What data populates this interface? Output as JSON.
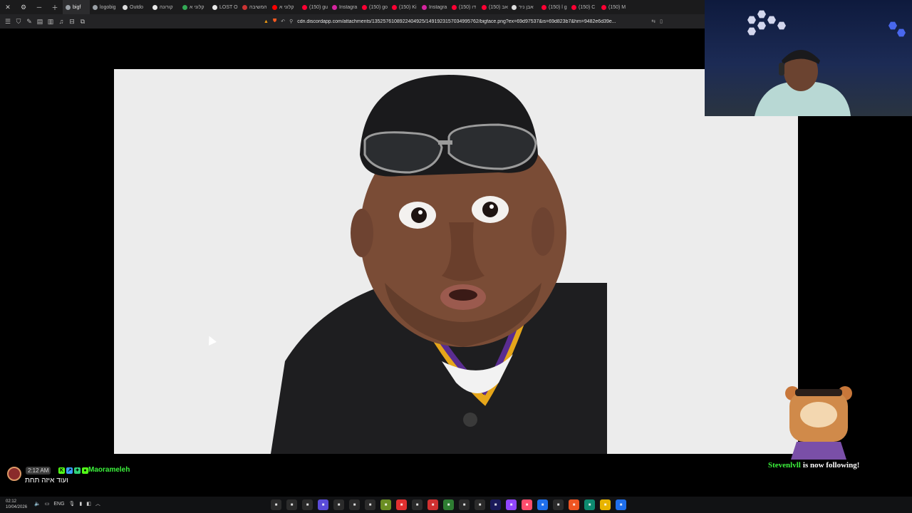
{
  "browser": {
    "tabs": [
      {
        "label": "bigf",
        "color": "#9aa0a6",
        "active": true
      },
      {
        "label": "logobig",
        "color": "#9aa0a6"
      },
      {
        "label": "Outdo",
        "color": "#dddddd"
      },
      {
        "label": "קורונה",
        "color": "#e9e9e9"
      },
      {
        "label": "קלוני א",
        "color": "#33aa55"
      },
      {
        "label": "LOST O",
        "color": "#e8e8e8"
      },
      {
        "label": "המשיבה",
        "color": "#cc3333"
      },
      {
        "label": "קלוני א",
        "color": "#ff0000"
      },
      {
        "label": "(150) gu",
        "color": "#ff0033"
      },
      {
        "label": "Instagra",
        "color": "#d6249f"
      },
      {
        "label": "(150) go",
        "color": "#ff0033"
      },
      {
        "label": "(150) Ki",
        "color": "#ff0033"
      },
      {
        "label": "Instagra",
        "color": "#d6249f"
      },
      {
        "label": "(150) דו",
        "color": "#ff0033"
      },
      {
        "label": "(150) אב",
        "color": "#ff0033"
      },
      {
        "label": "אבן ניר",
        "color": "#dddddd"
      },
      {
        "label": "(150) l g",
        "color": "#ff0033"
      },
      {
        "label": "(150) C",
        "color": "#ff0033"
      },
      {
        "label": "(150) M",
        "color": "#ff0033"
      }
    ],
    "url": "cdn.discordapp.com/attachments/1352576108922404925/1491923157034995762/bigface.png?ex=69d97537&is=69d823b7&hm=9482e6d39e..."
  },
  "chat": {
    "time": "2:12 AM",
    "username": "Maorameleh",
    "message": "ועוד איזה תחת",
    "badges": [
      {
        "char": "K",
        "color": "#53fc18"
      },
      {
        "char": "↗",
        "color": "#3aa0ff"
      },
      {
        "char": "✦",
        "color": "#32d27a"
      },
      {
        "char": "●",
        "color": "#53fc18"
      }
    ]
  },
  "follow_alert": {
    "name": "Stevenlvll",
    "text": "is now following!"
  },
  "taskbar": {
    "time": "02:12",
    "date": "10/04/2026",
    "lang": "ENG",
    "apps": [
      {
        "name": "media-player",
        "color": "#2b2b2b"
      },
      {
        "name": "brave",
        "color": "#2b2b2b"
      },
      {
        "name": "pin",
        "color": "#2b2b2b"
      },
      {
        "name": "grid",
        "color": "#5a4bd8"
      },
      {
        "name": "diamond",
        "color": "#2b2b2b"
      },
      {
        "name": "diamond-2",
        "color": "#2b2b2b"
      },
      {
        "name": "circle-app",
        "color": "#2b2b2b"
      },
      {
        "name": "minecraft",
        "color": "#6b8e23"
      },
      {
        "name": "red-app",
        "color": "#e03030"
      },
      {
        "name": "list",
        "color": "#2b2b2b"
      },
      {
        "name": "pdf",
        "color": "#d03030"
      },
      {
        "name": "android-studio",
        "color": "#2e7d32"
      },
      {
        "name": "chatgpt",
        "color": "#2b2b2b"
      },
      {
        "name": "red-circle",
        "color": "#2b2b2b"
      },
      {
        "name": "premiere",
        "color": "#1a1a5a"
      },
      {
        "name": "twitch-like",
        "color": "#9146ff"
      },
      {
        "name": "music",
        "color": "#ff4d6d"
      },
      {
        "name": "store",
        "color": "#1f6feb"
      },
      {
        "name": "chrome",
        "color": "#2b2b2b"
      },
      {
        "name": "brave-2",
        "color": "#ee5522"
      },
      {
        "name": "edge",
        "color": "#0d8a6f"
      },
      {
        "name": "explorer",
        "color": "#e8b400"
      },
      {
        "name": "windows",
        "color": "#1f6feb"
      }
    ]
  }
}
